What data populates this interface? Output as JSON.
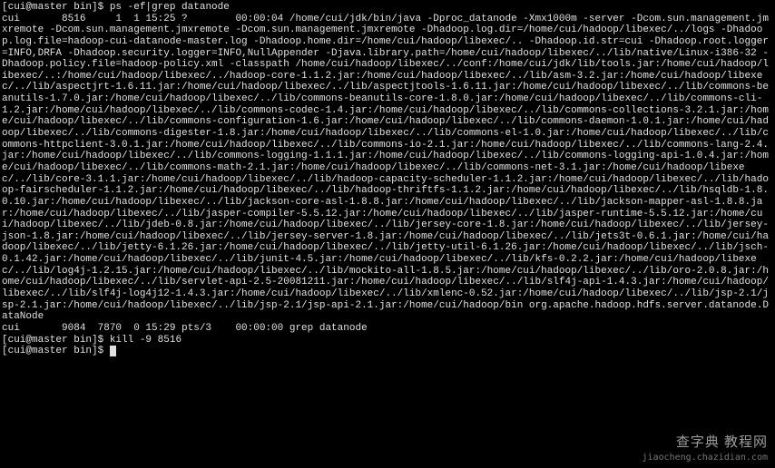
{
  "prompts": {
    "p1_prefix": "[cui@master bin]$ ",
    "p2_prefix": "[cui@master bin]$ ",
    "p3_prefix": "[cui@master bin]$ "
  },
  "commands": {
    "cmd1": "ps -ef|grep datanode",
    "cmd2": "kill -9 8516",
    "cmd3": ""
  },
  "ps_output_header": "cui       8516     1  1 15:25 ?        00:00:04 /home/cui/jdk/bin/java -Dproc_datanode -Xmx1000m -server -Dcom.sun.management.jmxremote -Dcom.sun.management.jmxremote -Dcom.sun.management.jmxremote -Dhadoop.log.dir=/home/cui/hadoop/libexec/../logs -Dhadoop.log.file=hadoop-cui-datanode-master.log -Dhadoop.home.dir=/home/cui/hadoop/libexec/.. -Dhadoop.id.str=cui -Dhadoop.root.logger=INFO,DRFA -Dhadoop.security.logger=INFO,NullAppender -Djava.library.path=/home/cui/hadoop/libexec/../lib/native/Linux-i386-32 -Dhadoop.policy.file=hadoop-policy.xml -classpath /home/cui/hadoop/libexec/../conf:/home/cui/jdk/lib/tools.jar:/home/cui/hadoop/libexec/..:/home/cui/hadoop/libexec/../hadoop-core-1.1.2.jar:/home/cui/hadoop/libexec/../lib/asm-3.2.jar:/home/cui/hadoop/libexec/../lib/aspectjrt-1.6.11.jar:/home/cui/hadoop/libexec/../lib/aspectjtools-1.6.11.jar:/home/cui/hadoop/libexec/../lib/commons-beanutils-1.7.0.jar:/home/cui/hadoop/libexec/../lib/commons-beanutils-core-1.8.0.jar:/home/cui/hadoop/libexec/../lib/commons-cli-1.2.jar:/home/cui/hadoop/libexec/../lib/commons-codec-1.4.jar:/home/cui/hadoop/libexec/../lib/commons-collections-3.2.1.jar:/home/cui/hadoop/libexec/../lib/commons-configuration-1.6.jar:/home/cui/hadoop/libexec/../lib/commons-daemon-1.0.1.jar:/home/cui/hadoop/libexec/../lib/commons-digester-1.8.jar:/home/cui/hadoop/libexec/../lib/commons-el-1.0.jar:/home/cui/hadoop/libexec/../lib/commons-httpclient-3.0.1.jar:/home/cui/hadoop/libexec/../lib/commons-io-2.1.jar:/home/cui/hadoop/libexec/../lib/commons-lang-2.4.jar:/home/cui/hadoop/libexec/../lib/commons-logging-1.1.1.jar:/home/cui/hadoop/libexec/../lib/commons-logging-api-1.0.4.jar:/home/cui/hadoop/libexec/../lib/commons-math-2.1.jar:/home/cui/hadoop/libexec/../lib/commons-net-3.1.jar:/home/cui/hadoop/libexec/../lib/core-3.1.1.jar:/home/cui/hadoop/libexec/../lib/hadoop-capacity-scheduler-1.1.2.jar:/home/cui/hadoop/libexec/../lib/hadoop-fairscheduler-1.1.2.jar:/home/cui/hadoop/libexec/../lib/hadoop-thriftfs-1.1.2.jar:/home/cui/hadoop/libexec/../lib/hsqldb-1.8.0.10.jar:/home/cui/hadoop/libexec/../lib/jackson-core-asl-1.8.8.jar:/home/cui/hadoop/libexec/../lib/jackson-mapper-asl-1.8.8.jar:/home/cui/hadoop/libexec/../lib/jasper-compiler-5.5.12.jar:/home/cui/hadoop/libexec/../lib/jasper-runtime-5.5.12.jar:/home/cui/hadoop/libexec/../lib/jdeb-0.8.jar:/home/cui/hadoop/libexec/../lib/jersey-core-1.8.jar:/home/cui/hadoop/libexec/../lib/jersey-json-1.8.jar:/home/cui/hadoop/libexec/../lib/jersey-server-1.8.jar:/home/cui/hadoop/libexec/../lib/jets3t-0.6.1.jar:/home/cui/hadoop/libexec/../lib/jetty-6.1.26.jar:/home/cui/hadoop/libexec/../lib/jetty-util-6.1.26.jar:/home/cui/hadoop/libexec/../lib/jsch-0.1.42.jar:/home/cui/hadoop/libexec/../lib/junit-4.5.jar:/home/cui/hadoop/libexec/../lib/kfs-0.2.2.jar:/home/cui/hadoop/libexec/../lib/log4j-1.2.15.jar:/home/cui/hadoop/libexec/../lib/mockito-all-1.8.5.jar:/home/cui/hadoop/libexec/../lib/oro-2.0.8.jar:/home/cui/hadoop/libexec/../lib/servlet-api-2.5-20081211.jar:/home/cui/hadoop/libexec/../lib/slf4j-api-1.4.3.jar:/home/cui/hadoop/libexec/../lib/slf4j-log4j12-1.4.3.jar:/home/cui/hadoop/libexec/../lib/xmlenc-0.52.jar:/home/cui/hadoop/libexec/../lib/jsp-2.1/jsp-2.1.jar:/home/cui/hadoop/libexec/../lib/jsp-2.1/jsp-api-2.1.jar:/home/cui/hadoop/bin org.apache.hadoop.hdfs.server.datanode.DataNode",
  "ps_grep_line": "cui       9084  7870  0 15:29 pts/3    00:00:00 grep datanode",
  "watermark": {
    "main": "查字典  教程网",
    "sub": "jiaocheng.chazidian.com"
  }
}
